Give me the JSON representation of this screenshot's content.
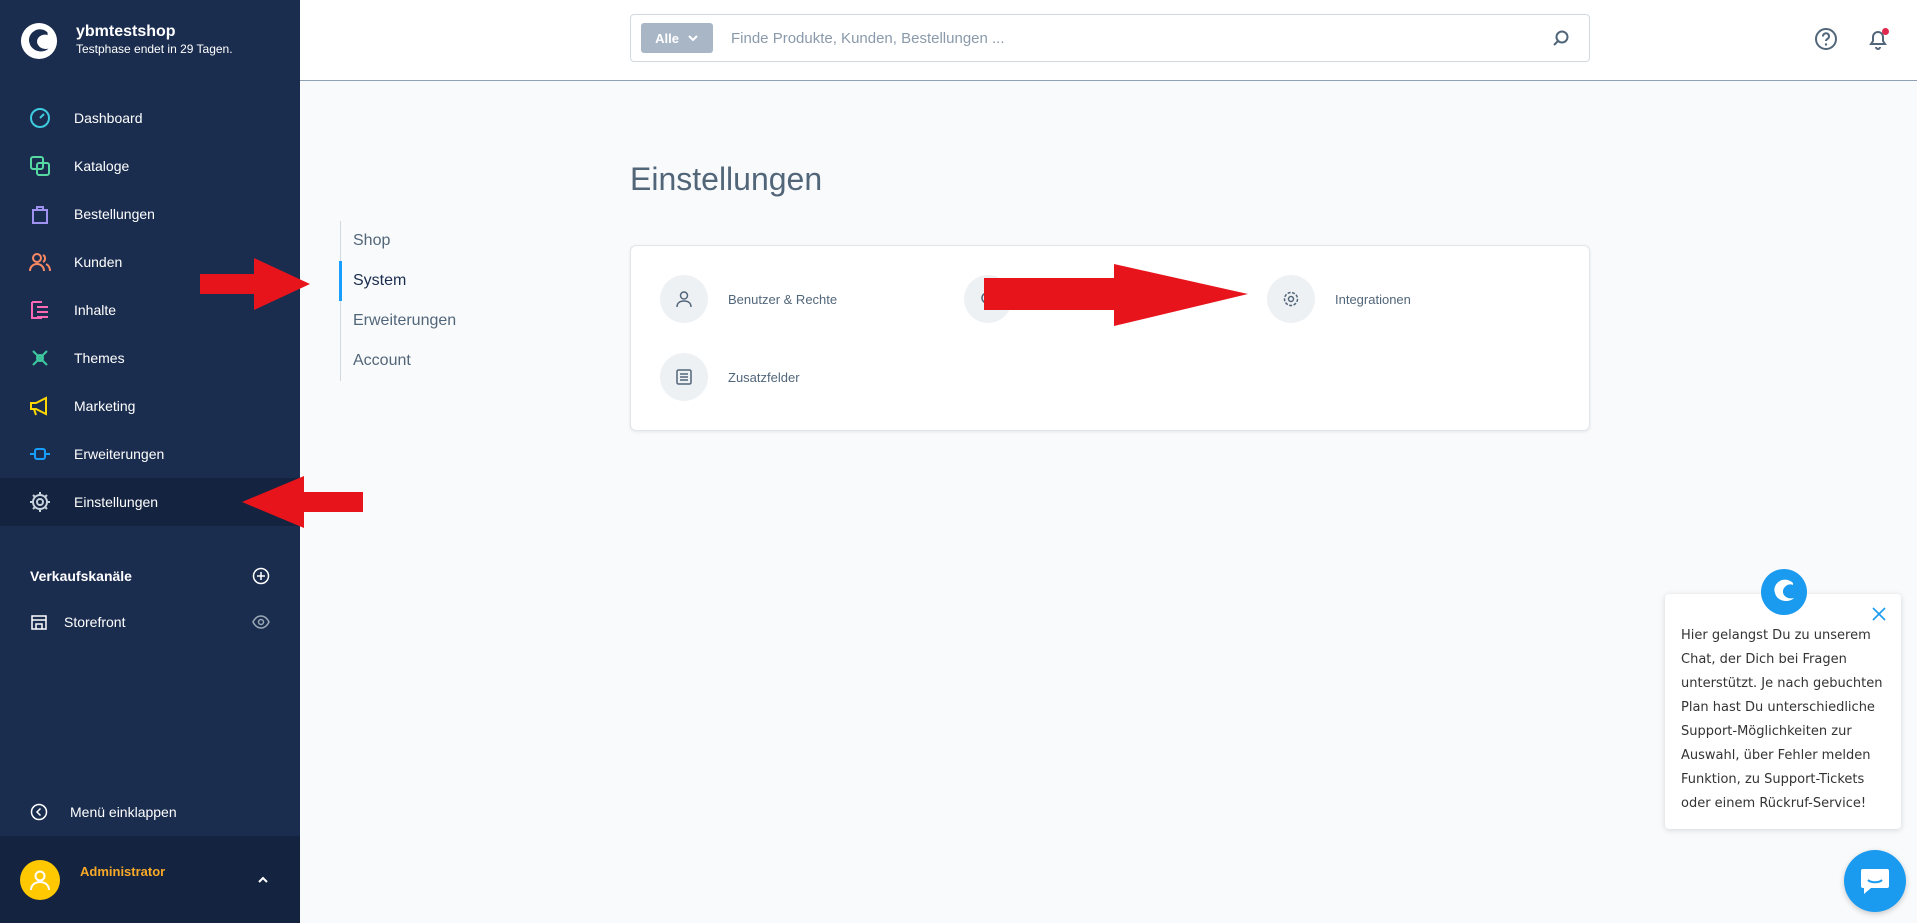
{
  "brand": {
    "name": "ybmtestshop",
    "subtitle": "Testphase endet in 29 Tagen."
  },
  "nav": [
    {
      "label": "Dashboard",
      "icon": "dashboard-icon",
      "color": "#3ecbe0"
    },
    {
      "label": "Kataloge",
      "icon": "catalog-icon",
      "color": "#57d9a3"
    },
    {
      "label": "Bestellungen",
      "icon": "orders-icon",
      "color": "#a092f0"
    },
    {
      "label": "Kunden",
      "icon": "customers-icon",
      "color": "#f88962"
    },
    {
      "label": "Inhalte",
      "icon": "content-icon",
      "color": "#ff68b4"
    },
    {
      "label": "Themes",
      "icon": "themes-icon",
      "color": "#3ecba0"
    },
    {
      "label": "Marketing",
      "icon": "marketing-icon",
      "color": "#ffd700"
    },
    {
      "label": "Erweiterungen",
      "icon": "extensions-icon",
      "color": "#189eff"
    },
    {
      "label": "Einstellungen",
      "icon": "settings-icon",
      "color": "#9aa8b5"
    }
  ],
  "sales_channels": {
    "heading": "Verkaufskanäle",
    "items": [
      {
        "label": "Storefront"
      }
    ]
  },
  "collapse_label": "Menü einklappen",
  "user": {
    "name": "Administrator"
  },
  "search": {
    "type_label": "Alle",
    "placeholder": "Finde Produkte, Kunden, Bestellungen ..."
  },
  "page": {
    "title": "Einstellungen"
  },
  "tabs": [
    {
      "label": "Shop",
      "active": false
    },
    {
      "label": "System",
      "active": true
    },
    {
      "label": "Erweiterungen",
      "active": false
    },
    {
      "label": "Account",
      "active": false
    }
  ],
  "settings_items": [
    {
      "label": "Benutzer & Rechte",
      "icon": "user-icon"
    },
    {
      "label": "",
      "icon": "search-icon"
    },
    {
      "label": "Integrationen",
      "icon": "gear-icon"
    },
    {
      "label": "Zusatzfelder",
      "icon": "list-icon"
    }
  ],
  "chat": {
    "text": "Hier gelangst Du zu unserem Chat, der Dich bei Fragen unterstützt. Je nach gebuchten Plan hast Du unterschiedliche Support-Möglichkeiten zur Auswahl, über Fehler melden Funktion, zu Support-Tickets oder einem Rückruf-Service!"
  },
  "colors": {
    "sidebar": "#1b2d4f",
    "accent": "#189eff",
    "arrow": "#e8141c"
  }
}
